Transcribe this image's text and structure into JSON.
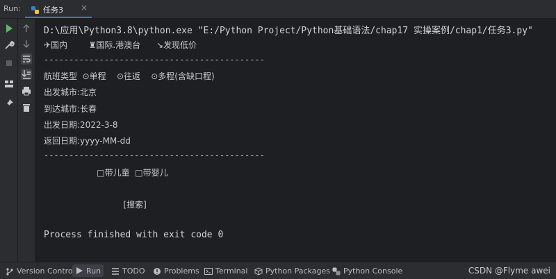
{
  "run_header": {
    "label": "Run:",
    "tab_title": "任务3",
    "tab_close": "×"
  },
  "console": {
    "lines": [
      "D:\\应用\\Python3.8\\python.exe \"E:/Python Project/Python基础语法/chap17 实操案例/chap1/任务3.py\"",
      "✈国内        ♜国际.港澳台      ↘发现低价",
      "--------------------------------------------",
      "航班类型  ⊙单程    ⊙往返    ⊙多程(含缺口程)",
      "出发城市:北京",
      "到达城市:长春",
      "出发日期:2022-3-8",
      "返回日期:yyyy-MM-dd",
      "--------------------------------------------",
      "                    □带儿童  □带婴儿",
      "                              [搜索]",
      "Process finished with exit code 0"
    ]
  },
  "bottom_bar": {
    "items": [
      {
        "label": "Version Control",
        "icon": "branch-icon"
      },
      {
        "label": "Run",
        "icon": "run-icon"
      },
      {
        "label": "TODO",
        "icon": "todo-icon"
      },
      {
        "label": "Problems",
        "icon": "problems-icon"
      },
      {
        "label": "Terminal",
        "icon": "terminal-icon"
      },
      {
        "label": "Python Packages",
        "icon": "packages-icon"
      },
      {
        "label": "Python Console",
        "icon": "python-console-icon"
      }
    ],
    "watermark": "CSDN @Flyme awei"
  },
  "colors": {
    "accent": "#3574f0",
    "run_green": "#5fb865",
    "console_bg": "#1e1f22",
    "panel_bg": "#2b2d30"
  }
}
